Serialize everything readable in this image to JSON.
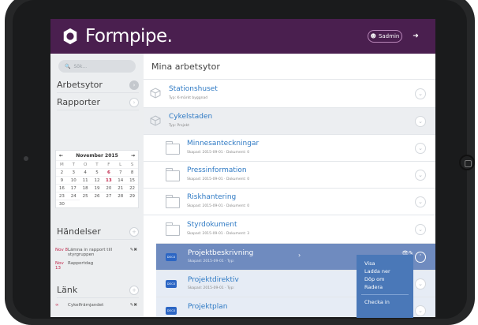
{
  "brand": {
    "name": "Formpipe."
  },
  "header": {
    "user_label": "Sadmin"
  },
  "sidebar": {
    "search_placeholder": "Sök...",
    "sections": {
      "workspaces": "Arbetsytor",
      "reports": "Rapporter",
      "events": "Händelser",
      "links": "Länk"
    },
    "calendar": {
      "month": "November 2015",
      "prev": "←",
      "next": "→",
      "days": [
        "M",
        "T",
        "O",
        "T",
        "F",
        "L",
        "S"
      ],
      "weeks": [
        [
          "",
          "",
          "",
          "",
          "",
          "",
          "1"
        ],
        [
          "2",
          "3",
          "4",
          "5",
          "6",
          "7",
          "8"
        ],
        [
          "9",
          "10",
          "11",
          "12",
          "13",
          "14",
          "15"
        ],
        [
          "16",
          "17",
          "18",
          "19",
          "20",
          "21",
          "22"
        ],
        [
          "23",
          "24",
          "25",
          "26",
          "27",
          "28",
          "29"
        ],
        [
          "30",
          "",
          "",
          "",
          "",
          "",
          ""
        ]
      ]
    },
    "events": [
      {
        "date": "Nov 8",
        "text": "Lämna in rapport till styrgruppen"
      },
      {
        "date": "Nov 13",
        "text": "Rapportdag"
      }
    ],
    "links": [
      {
        "text": "Cykelfrämjandet"
      }
    ]
  },
  "main": {
    "title": "Mina arbetsytor",
    "items": [
      {
        "name": "Stationshuset",
        "meta": "Typ: K-märkt byggnad"
      },
      {
        "name": "Cykelstaden",
        "meta": "Typ: Projekt"
      },
      {
        "name": "Minnesanteckningar",
        "meta": "Skapad: 2015-09-01 · Dokument: 0"
      },
      {
        "name": "Pressinformation",
        "meta": "Skapad: 2015-09-01 · Dokument: 0"
      },
      {
        "name": "Riskhantering",
        "meta": "Skapad: 2015-09-01 · Dokument: 0"
      },
      {
        "name": "Styrdokument",
        "meta": "Skapad: 2015-09-01 · Dokument: 3"
      },
      {
        "name": "Projektbeskrivning",
        "meta": "Skapad: 2015-09-01 · Typ:"
      },
      {
        "name": "Projektdirektiv",
        "meta": "Skapad: 2015-09-01 · Typ:"
      },
      {
        "name": "Projektplan",
        "meta": ""
      }
    ],
    "doc_badge": "DOCX"
  },
  "context_menu": {
    "items": [
      "Visa",
      "Ladda ner",
      "Döp om",
      "Radera"
    ],
    "extra": "Checka in"
  }
}
